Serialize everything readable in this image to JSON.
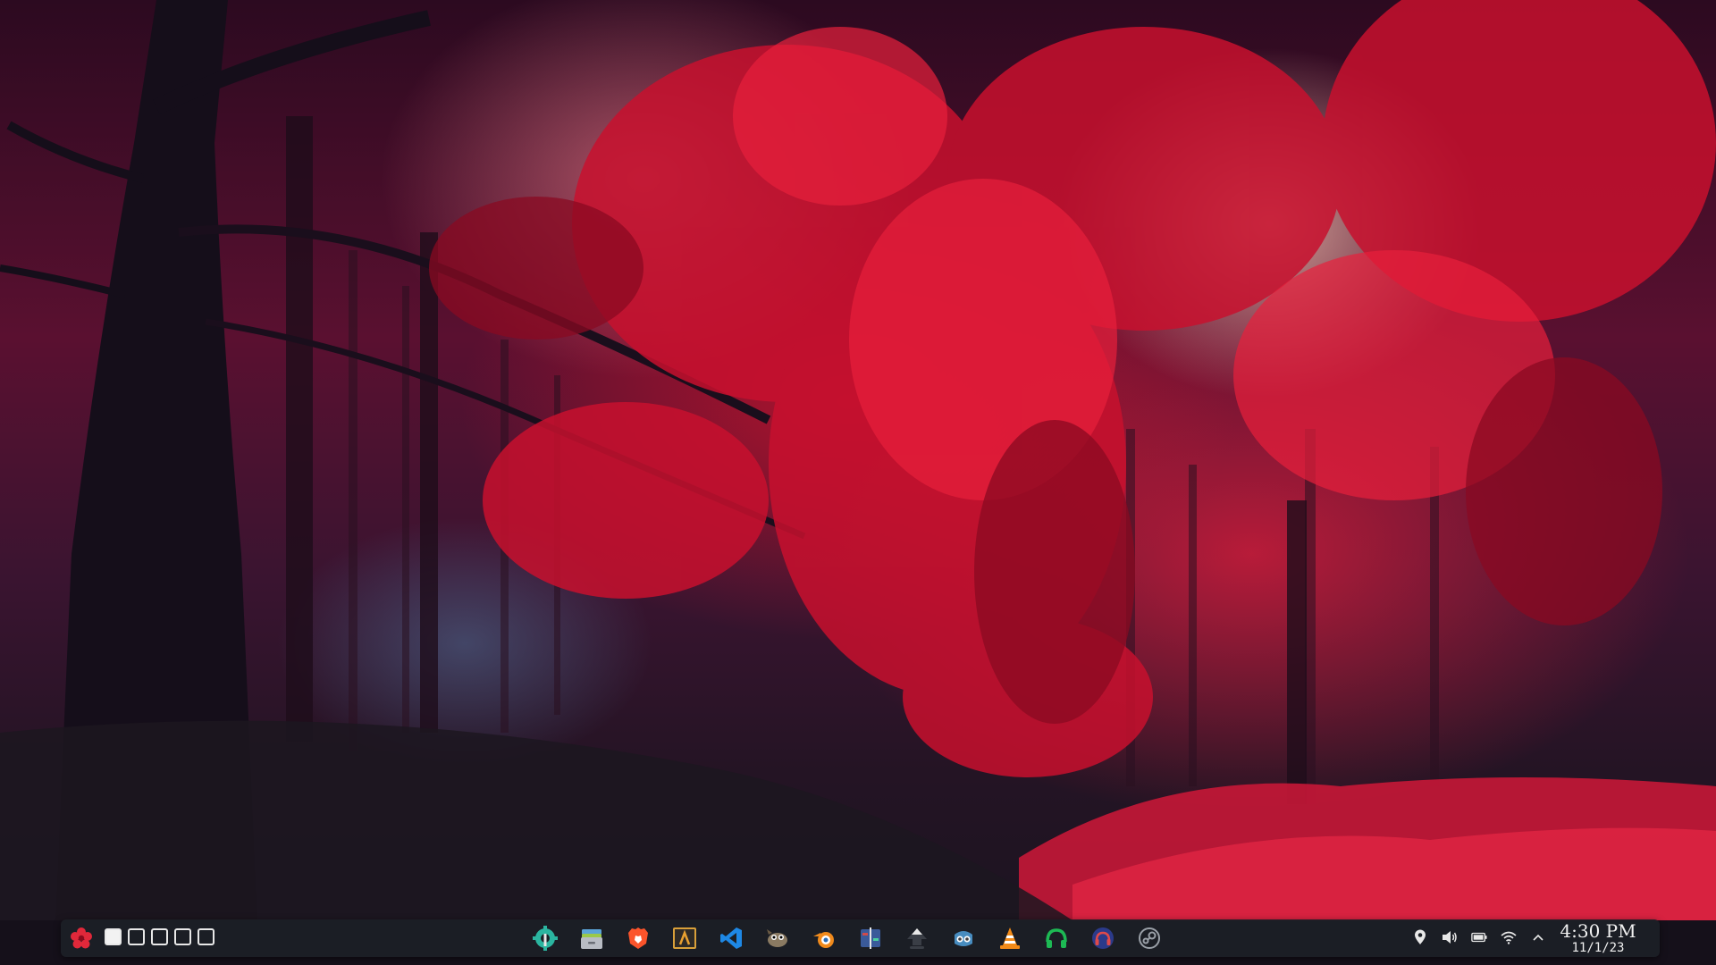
{
  "colors": {
    "taskbar_bg": "#1c2026",
    "workspace_border": "#e8e8e8",
    "start_icon": "#e0283a",
    "clock_text": "#f0f0f0"
  },
  "start_menu": {
    "icon": "flower-icon"
  },
  "workspaces": [
    {
      "index": 1,
      "active": true
    },
    {
      "index": 2,
      "active": false
    },
    {
      "index": 3,
      "active": false
    },
    {
      "index": 4,
      "active": false
    },
    {
      "index": 5,
      "active": false
    }
  ],
  "pinned_apps": [
    {
      "icon": "gear-wrench-icon"
    },
    {
      "icon": "file-manager-icon"
    },
    {
      "icon": "brave-lion-icon"
    },
    {
      "icon": "text-editor-icon"
    },
    {
      "icon": "vscode-icon"
    },
    {
      "icon": "gimp-icon"
    },
    {
      "icon": "blender-icon"
    },
    {
      "icon": "video-editor-icon"
    },
    {
      "icon": "inkscape-icon"
    },
    {
      "icon": "godot-icon"
    },
    {
      "icon": "vlc-cone-icon"
    },
    {
      "icon": "spotify-headphones-icon"
    },
    {
      "icon": "music-headphones-icon"
    },
    {
      "icon": "steam-icon"
    }
  ],
  "tray": [
    {
      "icon": "location-pin-icon"
    },
    {
      "icon": "volume-icon"
    },
    {
      "icon": "battery-icon"
    },
    {
      "icon": "wifi-icon"
    },
    {
      "icon": "chevron-up-icon"
    }
  ],
  "clock": {
    "time": "4:30 PM",
    "date": "11/1/23"
  }
}
